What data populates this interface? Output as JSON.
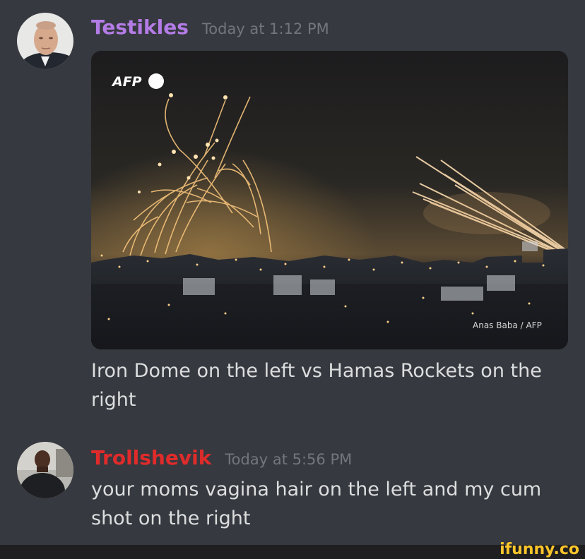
{
  "messages": [
    {
      "username": "Testikles",
      "username_color": "#b47ce6",
      "timestamp": "Today at 1:12 PM",
      "text": "Iron Dome on the left vs Hamas Rockets on the right",
      "attachment": {
        "logo_text": "AFP",
        "credit": "Anas Baba / AFP"
      }
    },
    {
      "username": "Trollshevik",
      "username_color": "#e02b2b",
      "timestamp": "Today at 5:56 PM",
      "text": "your moms vagina hair on the left and my cum shot on the right"
    }
  ],
  "watermark": {
    "text": "ifunny.co",
    "color": "#fbc42a"
  }
}
